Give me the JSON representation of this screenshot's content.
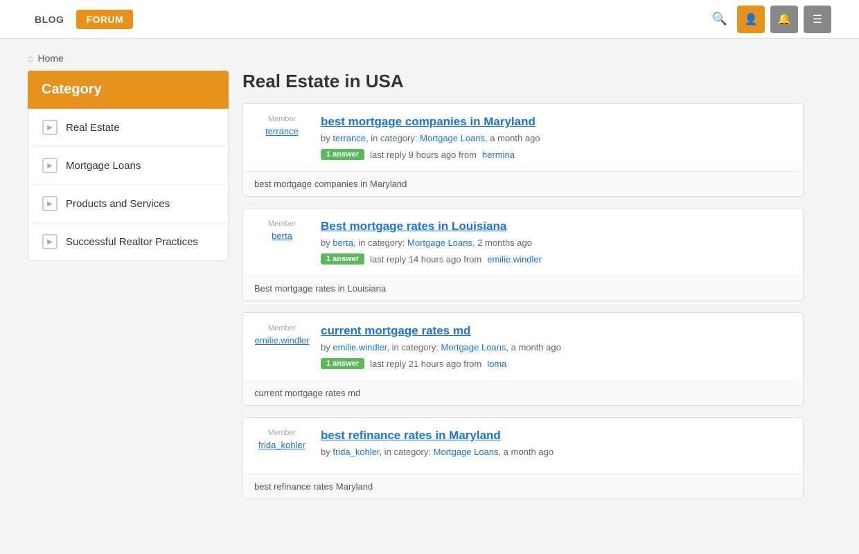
{
  "header": {
    "nav": [
      {
        "label": "BLOG",
        "href": "#"
      },
      {
        "label": "FORUM",
        "href": "#"
      }
    ],
    "icons": [
      {
        "name": "search",
        "symbol": "🔍",
        "style": "plain"
      },
      {
        "name": "user",
        "symbol": "👤",
        "style": "orange"
      },
      {
        "name": "bell",
        "symbol": "🔔",
        "style": "gray"
      },
      {
        "name": "menu",
        "symbol": "☰",
        "style": "gray"
      }
    ]
  },
  "breadcrumb": {
    "home": "Home"
  },
  "sidebar": {
    "header": "Category",
    "items": [
      {
        "label": "Real Estate"
      },
      {
        "label": "Mortgage Loans"
      },
      {
        "label": "Products and Services"
      },
      {
        "label": "Successful Realtor Practices"
      }
    ]
  },
  "content": {
    "title": "Real Estate in USA",
    "posts": [
      {
        "id": 1,
        "member_label": "Member",
        "member_name": "terrance",
        "title": "best mortgage companies in Maryland",
        "meta_by": "terrance",
        "meta_in_category": "Mortgage Loans",
        "meta_time": "a month ago",
        "answer_count": "1 answer",
        "reply_time": "9 hours ago",
        "reply_from": "hermina",
        "preview": "best mortgage companies in Maryland"
      },
      {
        "id": 2,
        "member_label": "Member",
        "member_name": "berta",
        "title": "Best mortgage rates in Louisiana",
        "meta_by": "berta",
        "meta_in_category": "Mortgage Loans",
        "meta_time": "2 months ago",
        "answer_count": "1 answer",
        "reply_time": "14 hours ago",
        "reply_from": "emilie.windler",
        "preview": "Best mortgage rates in Louisiana"
      },
      {
        "id": 3,
        "member_label": "Member",
        "member_name": "emilie.windler",
        "title": "current mortgage rates md",
        "meta_by": "emilie.windler",
        "meta_in_category": "Mortgage Loans",
        "meta_time": "a month ago",
        "answer_count": "1 answer",
        "reply_time": "21 hours ago",
        "reply_from": "loma",
        "preview": "current mortgage rates md"
      },
      {
        "id": 4,
        "member_label": "Member",
        "member_name": "frida_kohler",
        "title": "best refinance rates in Maryland",
        "meta_by": "frida_kohler",
        "meta_in_category": "Mortgage Loans",
        "meta_time": "a month ago",
        "answer_count": null,
        "reply_time": null,
        "reply_from": null,
        "preview": "best refinance rates Maryland"
      }
    ]
  }
}
